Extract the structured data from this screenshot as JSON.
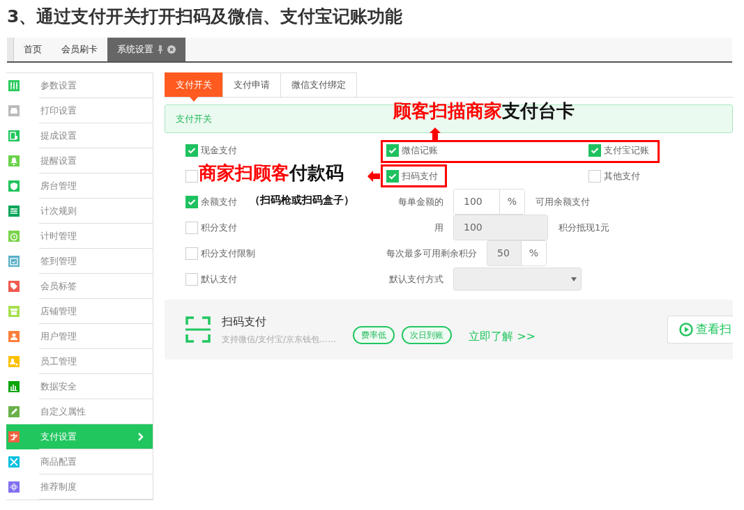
{
  "page_title": "3、通过支付开关打开扫码及微信、支付宝记账功能",
  "top_tabs": [
    {
      "label": "首页",
      "selected": false
    },
    {
      "label": "会员刷卡",
      "selected": false
    },
    {
      "label": "系统设置",
      "selected": true
    }
  ],
  "sidebar": {
    "items": [
      {
        "label": "参数设置",
        "color": "#2ecc5f",
        "selected": false
      },
      {
        "label": "打印设置",
        "color": "#bbbbbb",
        "selected": false
      },
      {
        "label": "提成设置",
        "color": "#22c55e",
        "selected": false
      },
      {
        "label": "提醒设置",
        "color": "#6ad24a",
        "selected": false
      },
      {
        "label": "房台管理",
        "color": "#1fc45a",
        "selected": false
      },
      {
        "label": "计次规则",
        "color": "#0aa55a",
        "selected": false
      },
      {
        "label": "计时管理",
        "color": "#7ad44a",
        "selected": false
      },
      {
        "label": "签到管理",
        "color": "#5ab0c8",
        "selected": false
      },
      {
        "label": "会员标签",
        "color": "#f05a50",
        "selected": false
      },
      {
        "label": "店铺管理",
        "color": "#a8e050",
        "selected": false
      },
      {
        "label": "用户管理",
        "color": "#ff7f3a",
        "selected": false
      },
      {
        "label": "员工管理",
        "color": "#ffc000",
        "selected": false
      },
      {
        "label": "数据安全",
        "color": "#0aa50a",
        "selected": false
      },
      {
        "label": "自定义属性",
        "color": "#6ab04a",
        "selected": false
      },
      {
        "label": "支付设置",
        "color": "#f06040",
        "selected": true
      },
      {
        "label": "商品配置",
        "color": "#00c0e0",
        "selected": false
      },
      {
        "label": "推荐制度",
        "color": "#8070f0",
        "selected": false
      }
    ]
  },
  "content_tabs": [
    {
      "label": "支付开关",
      "selected": true
    },
    {
      "label": "支付申请",
      "selected": false
    },
    {
      "label": "微信支付绑定",
      "selected": false
    }
  ],
  "section_header": "支付开关",
  "options": [
    {
      "cells": [
        {
          "kind": "checkbox",
          "label": "现金支付",
          "checked": true
        },
        {
          "kind": "checkbox",
          "label": "微信记账",
          "checked": true
        },
        {
          "kind": "checkbox",
          "label": "支付宝记账",
          "checked": true
        }
      ]
    },
    {
      "cells": [
        {
          "kind": "checkbox",
          "checked": false
        },
        {
          "kind": "checkbox",
          "label": "扫码支付",
          "checked": true
        },
        {
          "kind": "checkbox",
          "label": "其他支付",
          "checked": false
        }
      ]
    },
    {
      "cells": [
        {
          "kind": "checkbox",
          "label": "余额支付",
          "checked": true
        },
        {
          "kind": "setting",
          "label": "每单金额的",
          "value": "100",
          "disabled": false,
          "unit": "%",
          "note": "可用余额支付"
        }
      ]
    },
    {
      "cells": [
        {
          "kind": "checkbox",
          "label": "积分支付",
          "checked": false
        },
        {
          "kind": "setting",
          "label": "用",
          "value": "100",
          "disabled": true,
          "note": "积分抵现1元"
        }
      ]
    },
    {
      "cells": [
        {
          "kind": "checkbox",
          "label": "积分支付限制",
          "checked": false
        },
        {
          "kind": "setting",
          "label": "每次最多可用剩余积分",
          "value": "50",
          "disabled": true,
          "unit": "%"
        }
      ]
    },
    {
      "cells": [
        {
          "kind": "checkbox",
          "label": "默认支付",
          "checked": false
        },
        {
          "kind": "select",
          "label": "默认支付方式",
          "disabled": true
        }
      ]
    }
  ],
  "scan_card": {
    "title": "扫码支付",
    "description": "支持微信/支付宝/京东钱包……",
    "tags": [
      "费率低",
      "次日到账"
    ],
    "link": "立即了解 >>",
    "button": "查看扫"
  },
  "annotations": [
    {
      "kind": "up",
      "parts": [
        {
          "text": "顾客扫描商家",
          "color": "#ff0000"
        },
        {
          "text": "支付台卡",
          "color": "#111111"
        }
      ]
    },
    {
      "kind": "left",
      "parts": [
        {
          "text": "商家扫顾客",
          "color": "#ff0000"
        },
        {
          "text": "付款码",
          "color": "#111111"
        }
      ],
      "note": "（扫码枪或扫码盒子）"
    }
  ]
}
